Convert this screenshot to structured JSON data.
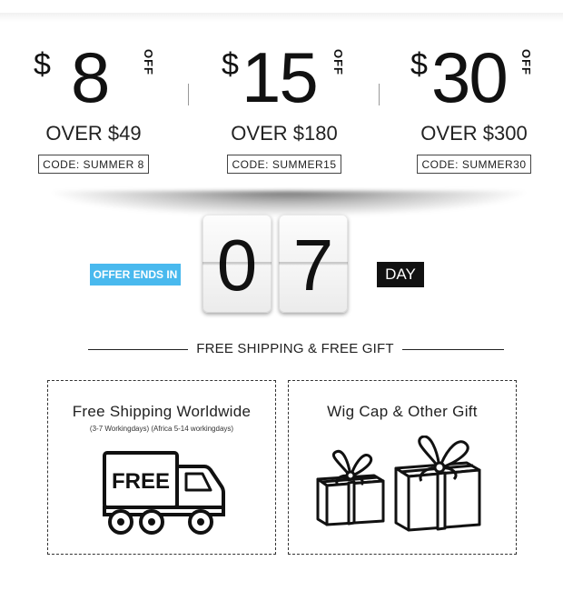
{
  "coupons": [
    {
      "currency": "$",
      "amount": "8",
      "off": "OFF",
      "over": "OVER $49",
      "code": "CODE: SUMMER 8"
    },
    {
      "currency": "$",
      "amount": "15",
      "off": "OFF",
      "over": "OVER $180",
      "code": "CODE: SUMMER15"
    },
    {
      "currency": "$",
      "amount": "30",
      "off": "OFF",
      "over": "OVER $300",
      "code": "CODE: SUMMER30"
    }
  ],
  "countdown": {
    "label": "OFFER ENDS IN",
    "digits": [
      "0",
      "7"
    ],
    "unit": "DAY"
  },
  "free_section": {
    "title": "FREE SHIPPING & FREE GIFT"
  },
  "panels": {
    "shipping": {
      "title": "Free Shipping Worldwide",
      "subtitle": "(3-7 Workingdays) (Africa 5-14 workingdays)",
      "truck_text": "FREE",
      "icon": "delivery-truck-icon"
    },
    "gift": {
      "title": "Wig Cap & Other Gift",
      "icon": "gift-box-icon"
    }
  },
  "colors": {
    "accent_blue": "#49b9ee",
    "day_badge": "#111111",
    "text": "#111111"
  }
}
